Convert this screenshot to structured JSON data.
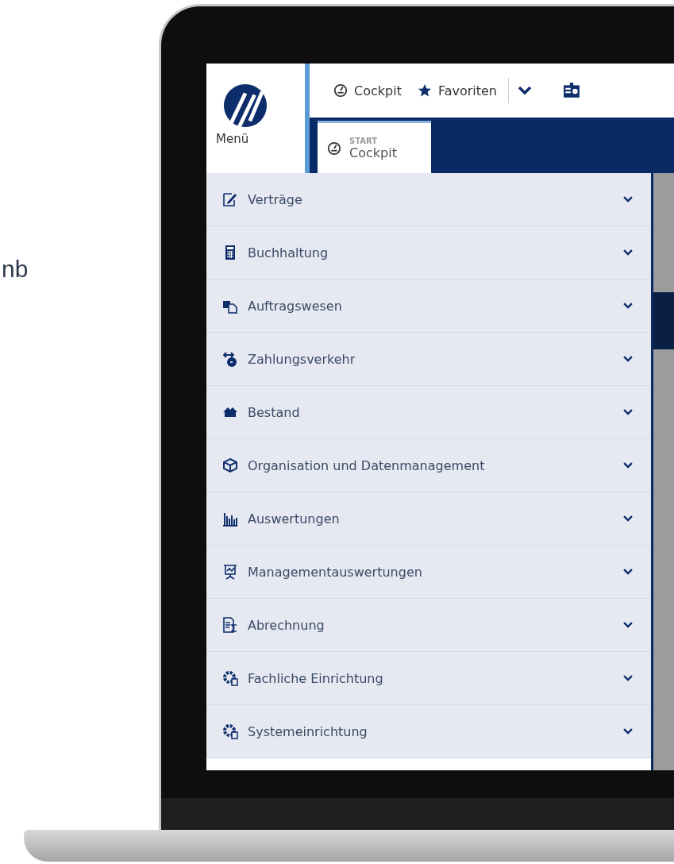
{
  "side_text": "nb",
  "header": {
    "menu_label": "Menü",
    "links": [
      {
        "kind": "cockpit",
        "label": "Cockpit"
      },
      {
        "kind": "favorites",
        "label": "Favoriten"
      }
    ]
  },
  "tabs": [
    {
      "overline": "START",
      "label": "Cockpit",
      "selected": true
    }
  ],
  "menu": {
    "items": [
      {
        "kind": "contract",
        "label": "Verträge",
        "expanded": false
      },
      {
        "kind": "calculator",
        "label": "Buchhaltung",
        "expanded": false
      },
      {
        "kind": "orders",
        "label": "Auftragswesen",
        "expanded": false
      },
      {
        "kind": "payment",
        "label": "Zahlungsverkehr",
        "expanded": false
      },
      {
        "kind": "houses",
        "label": "Bestand",
        "expanded": false
      },
      {
        "kind": "cube",
        "label": "Organisation und Datenmanagement",
        "expanded": false
      },
      {
        "kind": "barchart",
        "label": "Auswertungen",
        "expanded": false
      },
      {
        "kind": "presentation",
        "label": "Managementauswertungen",
        "expanded": false
      },
      {
        "kind": "sum",
        "label": "Abrechnung",
        "expanded": false
      },
      {
        "kind": "gear-doc",
        "label": "Fachliche Einrichtung",
        "expanded": false
      },
      {
        "kind": "gear-window",
        "label": "Systemeinrichtung",
        "expanded": false
      }
    ]
  }
}
